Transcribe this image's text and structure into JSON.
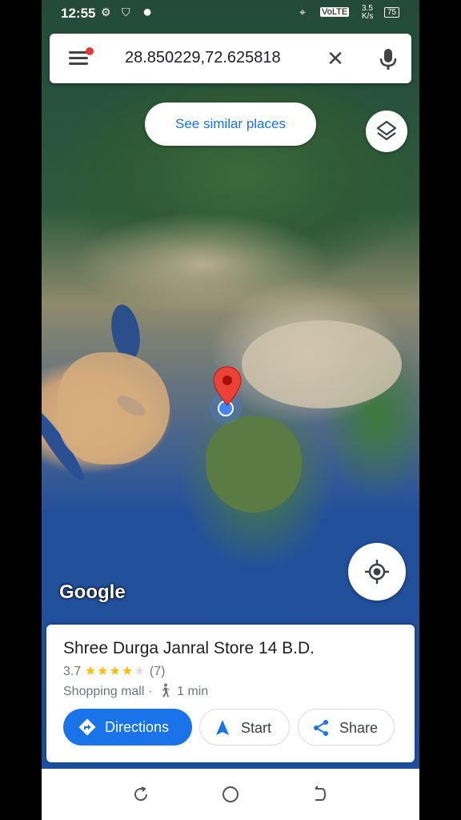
{
  "status_bar": {
    "time": "12:55",
    "network_speed": "3.5 K/s",
    "volte": "VoLTE",
    "battery": "75"
  },
  "search": {
    "query": "28.850229,72.625818"
  },
  "map": {
    "similar_places_label": "See similar places",
    "logo_text": "Google"
  },
  "place": {
    "name": "Shree Durga Janral Store 14 B.D.",
    "rating": "3.7",
    "stars": "★★★★",
    "stars_empty": "★",
    "review_count": "(7)",
    "category": "Shopping mall",
    "separator": "·",
    "walk_time": "1 min",
    "actions": {
      "directions": "Directions",
      "start": "Start",
      "share": "Share"
    }
  },
  "colors": {
    "accent": "#1a73e8",
    "pin": "#ea4335",
    "star": "#fbbc04"
  },
  "icons": [
    "gear-icon",
    "shield-icon",
    "menu-icon",
    "close-icon",
    "mic-icon",
    "layers-icon",
    "my-location-icon",
    "map-pin-icon",
    "walk-icon",
    "directions-icon",
    "navigation-arrow-icon",
    "share-icon"
  ]
}
